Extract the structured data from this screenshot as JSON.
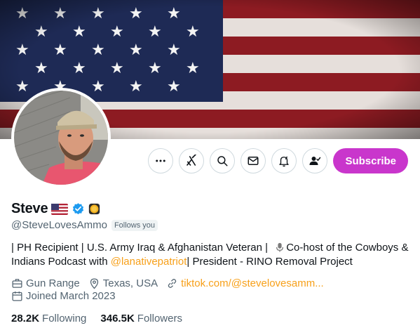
{
  "profile": {
    "display_name": "Steve",
    "handle": "@SteveLovesAmmo",
    "follows_you": "Follows you",
    "bio": {
      "part1": "| PH Recipient | U.S. Army Iraq & Afghanistan Veteran |",
      "part2": "Co-host of the Cowboys & Indians Podcast with ",
      "mention": "@lanativepatriot",
      "part3": "| President - RINO Removal Project"
    },
    "meta": {
      "category": "Gun Range",
      "location": "Texas, USA",
      "link": "tiktok.com/@stevelovesamm...",
      "joined": "Joined March 2023"
    },
    "stats": {
      "following_count": "28.2K",
      "following_label": "Following",
      "followers_count": "346.5K",
      "followers_label": "Followers"
    }
  },
  "actions": {
    "subscribe_label": "Subscribe",
    "icons": [
      "more-icon",
      "grok-icon",
      "search-icon",
      "message-icon",
      "notification-bell-icon",
      "follow-user-icon"
    ]
  },
  "colors": {
    "accent": "#c936cc",
    "link": "#f7a01a",
    "verified": "#1d9bf0",
    "secondary_text": "#536471"
  }
}
